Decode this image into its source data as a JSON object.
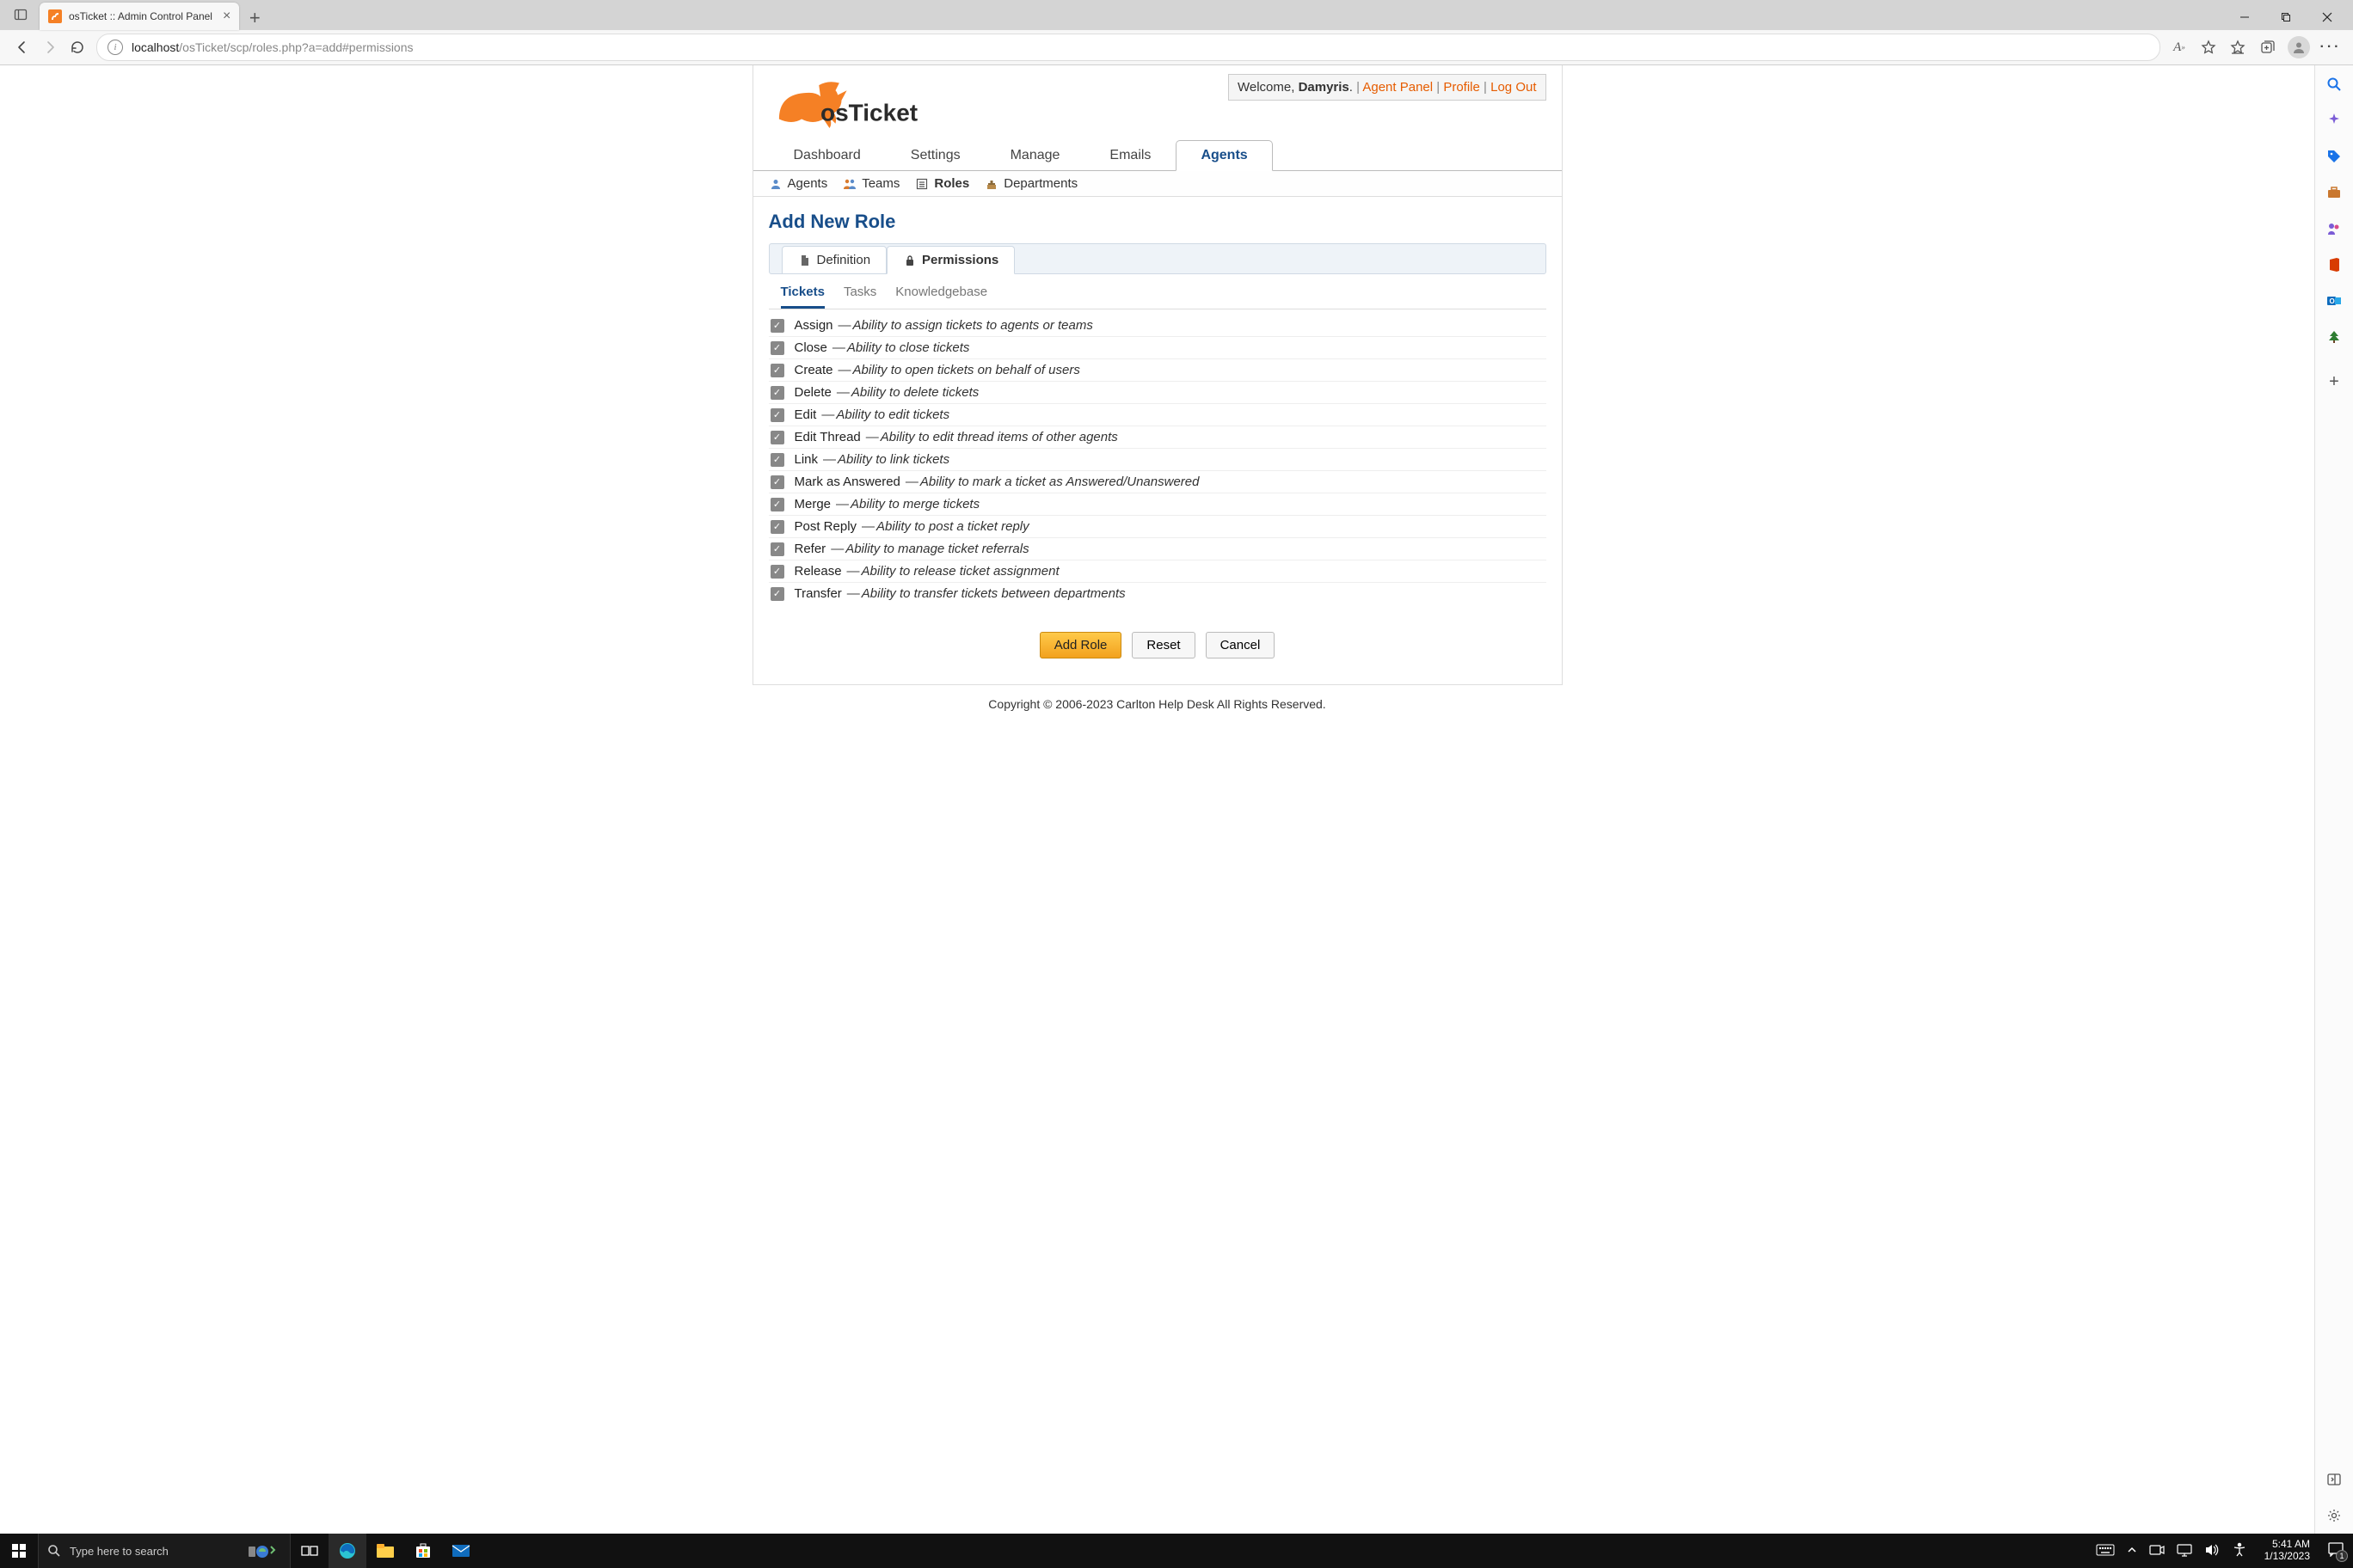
{
  "browser": {
    "tab_title": "osTicket :: Admin Control Panel",
    "url_host": "localhost",
    "url_path": "/osTicket/scp/roles.php?a=add#permissions"
  },
  "header": {
    "welcome_prefix": "Welcome, ",
    "user_name": "Damyris",
    "agent_panel": "Agent Panel",
    "profile": "Profile",
    "log_out": "Log Out"
  },
  "main_tabs": {
    "dashboard": "Dashboard",
    "settings": "Settings",
    "manage": "Manage",
    "emails": "Emails",
    "agents": "Agents"
  },
  "sub_tabs": {
    "agents": "Agents",
    "teams": "Teams",
    "roles": "Roles",
    "departments": "Departments"
  },
  "page_title": "Add New Role",
  "card_tabs": {
    "definition": "Definition",
    "permissions": "Permissions"
  },
  "perm_tabs": {
    "tickets": "Tickets",
    "tasks": "Tasks",
    "knowledgebase": "Knowledgebase"
  },
  "permissions": [
    {
      "name": "Assign",
      "desc": "Ability to assign tickets to agents or teams"
    },
    {
      "name": "Close",
      "desc": "Ability to close tickets"
    },
    {
      "name": "Create",
      "desc": "Ability to open tickets on behalf of users"
    },
    {
      "name": "Delete",
      "desc": "Ability to delete tickets"
    },
    {
      "name": "Edit",
      "desc": "Ability to edit tickets"
    },
    {
      "name": "Edit Thread",
      "desc": "Ability to edit thread items of other agents"
    },
    {
      "name": "Link",
      "desc": "Ability to link tickets"
    },
    {
      "name": "Mark as Answered",
      "desc": "Ability to mark a ticket as Answered/Unanswered"
    },
    {
      "name": "Merge",
      "desc": "Ability to merge tickets"
    },
    {
      "name": "Post Reply",
      "desc": "Ability to post a ticket reply"
    },
    {
      "name": "Refer",
      "desc": "Ability to manage ticket referrals"
    },
    {
      "name": "Release",
      "desc": "Ability to release ticket assignment"
    },
    {
      "name": "Transfer",
      "desc": "Ability to transfer tickets between departments"
    }
  ],
  "buttons": {
    "add_role": "Add Role",
    "reset": "Reset",
    "cancel": "Cancel"
  },
  "footer": "Copyright © 2006-2023 Carlton Help Desk All Rights Reserved.",
  "taskbar": {
    "search_placeholder": "Type here to search",
    "time": "5:41 AM",
    "date": "1/13/2023",
    "notif_count": "1"
  }
}
